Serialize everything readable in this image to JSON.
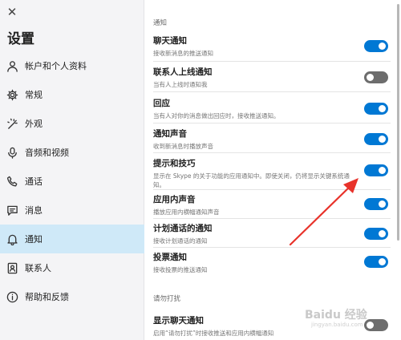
{
  "sidebar": {
    "close_icon": "close-icon",
    "title": "设置",
    "items": [
      {
        "label": "帐户和个人资料",
        "icon": "person-icon",
        "active": false
      },
      {
        "label": "常规",
        "icon": "gear-icon",
        "active": false
      },
      {
        "label": "外观",
        "icon": "magic-wand-icon",
        "active": false
      },
      {
        "label": "音频和视频",
        "icon": "microphone-icon",
        "active": false
      },
      {
        "label": "通话",
        "icon": "phone-icon",
        "active": false
      },
      {
        "label": "消息",
        "icon": "message-icon",
        "active": false
      },
      {
        "label": "通知",
        "icon": "bell-icon",
        "active": true
      },
      {
        "label": "联系人",
        "icon": "contacts-icon",
        "active": false
      },
      {
        "label": "帮助和反馈",
        "icon": "info-icon",
        "active": false
      }
    ]
  },
  "content": {
    "notifications_header": "通知",
    "settings": [
      {
        "title": "聊天通知",
        "desc": "接收新消息的推送通知",
        "on": true
      },
      {
        "title": "联系人上线通知",
        "desc": "当有人上线时通知我",
        "on": false
      },
      {
        "title": "回应",
        "desc": "当有人对你的消息做出回应时，接收推送通知。",
        "on": true
      },
      {
        "title": "通知声音",
        "desc": "收到新消息时播放声音",
        "on": true
      },
      {
        "title": "提示和技巧",
        "desc": "显示在 Skype 的关于功能的应用通知中。即使关闭，仍将显示关键系统通知。",
        "on": true
      },
      {
        "title": "应用内声音",
        "desc": "播放应用内横幅通知声音",
        "on": true
      },
      {
        "title": "计划通话的通知",
        "desc": "接收计划通话的通知",
        "on": true
      },
      {
        "title": "投票通知",
        "desc": "接收投票的推送通知",
        "on": true
      }
    ],
    "dnd_header": "请勿打扰",
    "dnd_setting": {
      "title": "显示聊天通知",
      "desc": "启用“请勿打扰”时接收推送和应用内横幅通知",
      "on": false
    }
  },
  "watermark": {
    "text": "Baidu 经验",
    "sub": "jingyan.baidu.com"
  },
  "colors": {
    "accent": "#0078d4",
    "toggle_off": "#6d6d6d",
    "sidebar_bg": "#f4f4f6",
    "active_bg": "#cfe9f8",
    "arrow": "#e8322a"
  }
}
